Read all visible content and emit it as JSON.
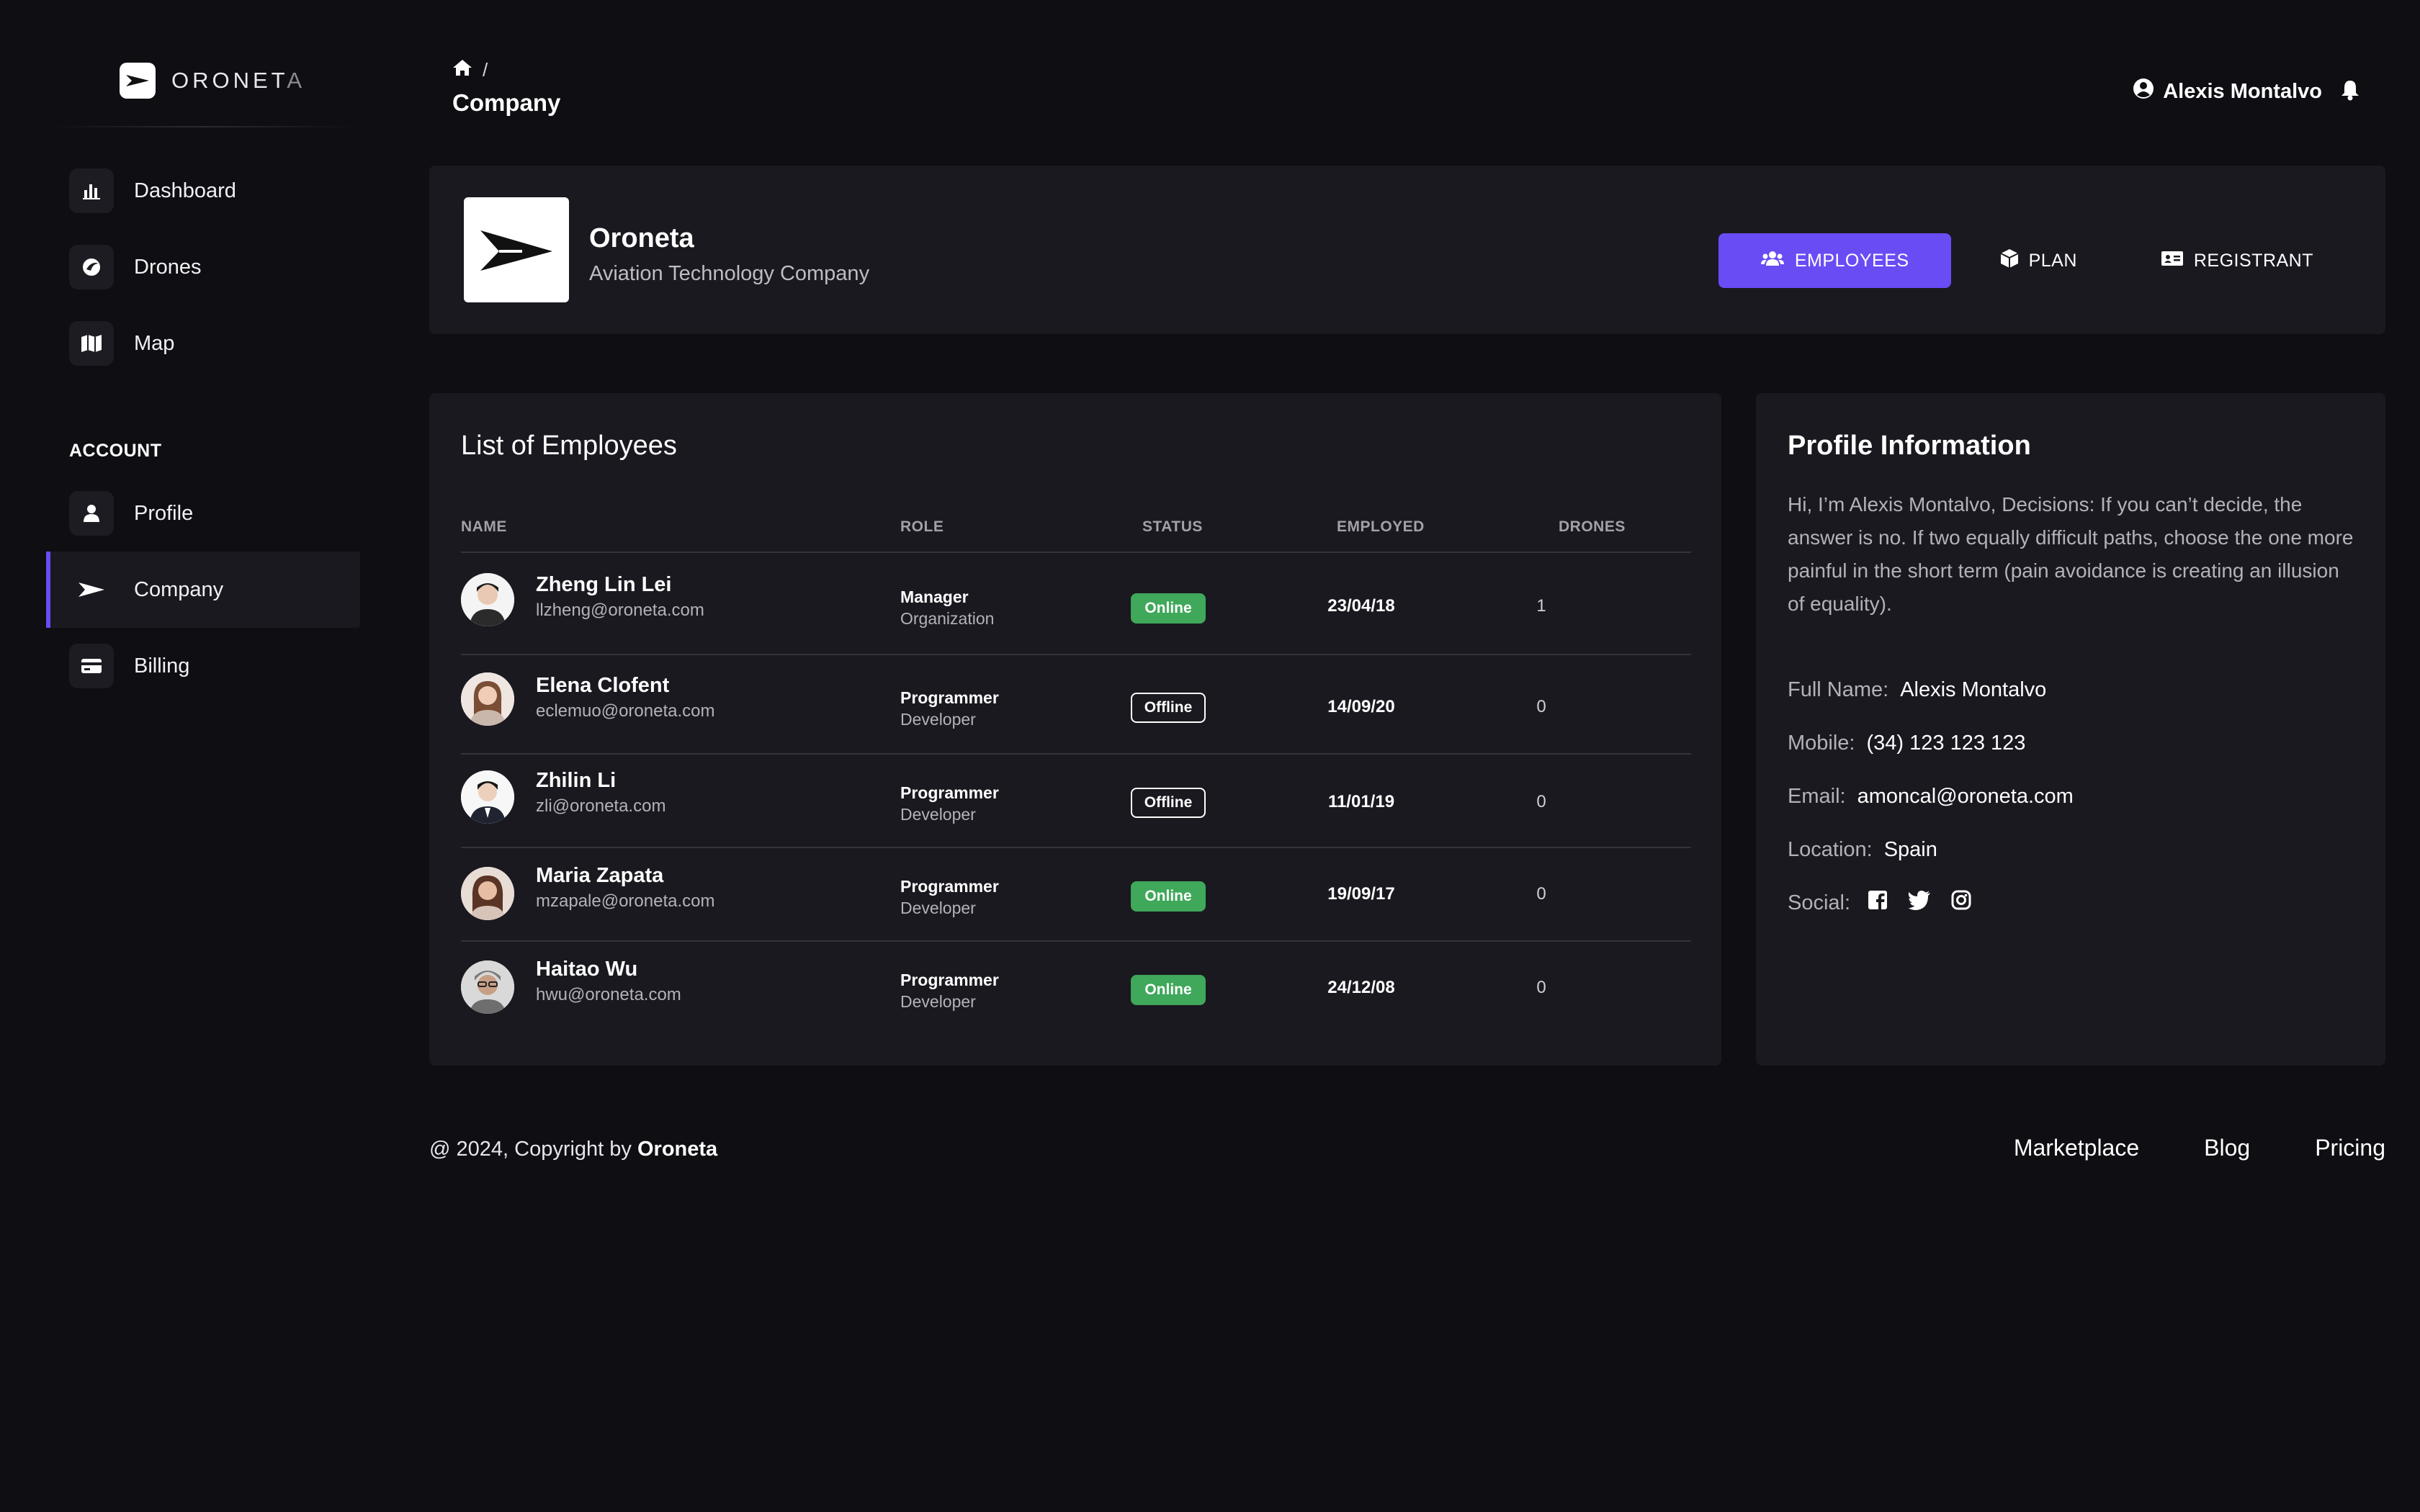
{
  "brand": {
    "name_main": "ORONET",
    "name_tail": "A"
  },
  "sidebar": {
    "items": [
      {
        "label": "Dashboard",
        "icon": "bar-chart-icon"
      },
      {
        "label": "Drones",
        "icon": "drone-icon"
      },
      {
        "label": "Map",
        "icon": "map-icon"
      }
    ],
    "account_label": "ACCOUNT",
    "account_items": [
      {
        "label": "Profile",
        "icon": "user-icon"
      },
      {
        "label": "Company",
        "icon": "plane-icon",
        "active": true
      },
      {
        "label": "Billing",
        "icon": "credit-card-icon"
      }
    ]
  },
  "header": {
    "breadcrumb_sep": "/",
    "title": "Company",
    "user_name": "Alexis Montalvo"
  },
  "company": {
    "name": "Oroneta",
    "subtitle": "Aviation Technology Company",
    "tabs": [
      {
        "label": "EMPLOYEES",
        "icon": "users-icon",
        "active": true
      },
      {
        "label": "PLAN",
        "icon": "cube-icon"
      },
      {
        "label": "REGISTRANT",
        "icon": "id-card-icon"
      }
    ]
  },
  "employees": {
    "title": "List of Employees",
    "columns": [
      "NAME",
      "ROLE",
      "STATUS",
      "EMPLOYED",
      "DRONES"
    ],
    "rows": [
      {
        "name": "Zheng Lin Lei",
        "email": "llzheng@oroneta.com",
        "role": "Manager",
        "dept": "Organization",
        "status": "Online",
        "employed": "23/04/18",
        "drones": "1"
      },
      {
        "name": "Elena Clofent",
        "email": "eclemuo@oroneta.com",
        "role": "Programmer",
        "dept": "Developer",
        "status": "Offline",
        "employed": "14/09/20",
        "drones": "0"
      },
      {
        "name": "Zhilin Li",
        "email": "zli@oroneta.com",
        "role": "Programmer",
        "dept": "Developer",
        "status": "Offline",
        "employed": "11/01/19",
        "drones": "0"
      },
      {
        "name": "Maria Zapata",
        "email": "mzapale@oroneta.com",
        "role": "Programmer",
        "dept": "Developer",
        "status": "Online",
        "employed": "19/09/17",
        "drones": "0"
      },
      {
        "name": "Haitao Wu",
        "email": "hwu@oroneta.com",
        "role": "Programmer",
        "dept": "Developer",
        "status": "Online",
        "employed": "24/12/08",
        "drones": "0"
      }
    ]
  },
  "profile": {
    "title": "Profile Information",
    "bio": "Hi, I’m Alexis Montalvo, Decisions: If you can’t decide, the answer is no. If two equally difficult paths, choose the one more painful in the short term (pain avoidance is creating an illusion of equality).",
    "full_name_label": "Full Name:",
    "full_name": "Alexis Montalvo",
    "mobile_label": "Mobile:",
    "mobile": "(34) 123 123 123",
    "email_label": "Email:",
    "email": "amoncal@oroneta.com",
    "location_label": "Location:",
    "location": "Spain",
    "social_label": "Social:"
  },
  "footer": {
    "copyright": "@ 2024, Copyright by",
    "brand": "Oroneta",
    "links": [
      "Marketplace",
      "Blog",
      "Pricing"
    ]
  },
  "colors": {
    "background": "#0f0e13",
    "card": "#1a1920",
    "accent": "#6a4cf5",
    "online": "#3fa85a"
  }
}
